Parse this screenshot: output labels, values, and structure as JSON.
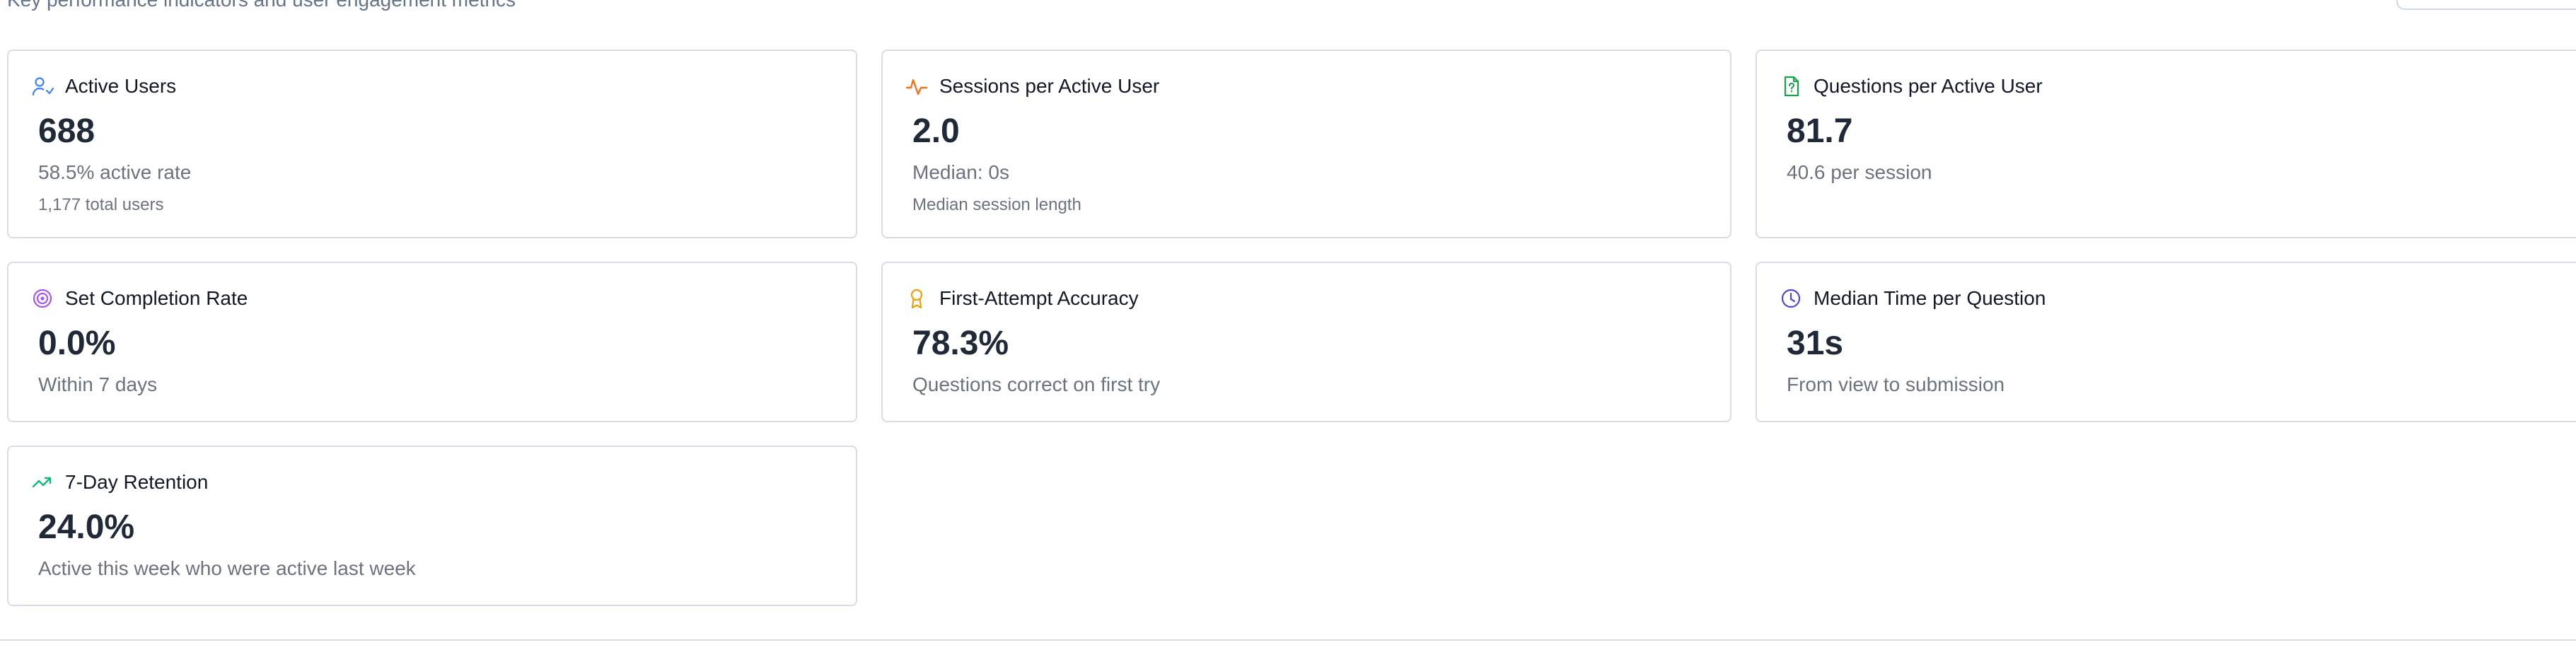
{
  "header": {
    "subtitle": "Key performance indicators and user engagement metrics"
  },
  "metrics": [
    {
      "title": "Active Users",
      "value": "688",
      "secondary": "58.5% active rate",
      "tertiary": "1,177 total users",
      "icon": "users-icon",
      "accent": "#3b82f6"
    },
    {
      "title": "Sessions per Active User",
      "value": "2.0",
      "secondary": "Median: 0s",
      "tertiary": "Median session length",
      "icon": "activity-icon",
      "accent": "#f97316"
    },
    {
      "title": "Questions per Active User",
      "value": "81.7",
      "secondary": "40.6 per session",
      "icon": "question-file-icon",
      "accent": "#16a34a"
    },
    {
      "title": "Set Completion Rate",
      "value": "0.0%",
      "secondary": "Within 7 days",
      "icon": "target-icon",
      "accent": "#a855f7"
    },
    {
      "title": "First-Attempt Accuracy",
      "value": "78.3%",
      "secondary": "Questions correct on first try",
      "icon": "award-icon",
      "accent": "#f59e0b"
    },
    {
      "title": "Median Time per Question",
      "value": "31s",
      "secondary": "From view to submission",
      "icon": "clock-icon",
      "accent": "#4f46e5"
    },
    {
      "title": "7-Day Retention",
      "value": "24.0%",
      "secondary": "Active this week who were active last week",
      "icon": "trending-up-icon",
      "accent": "#10b981"
    }
  ],
  "colors": {
    "border": "#d7dce6",
    "muted_text": "#6b7280",
    "value_text": "#1f2937"
  }
}
